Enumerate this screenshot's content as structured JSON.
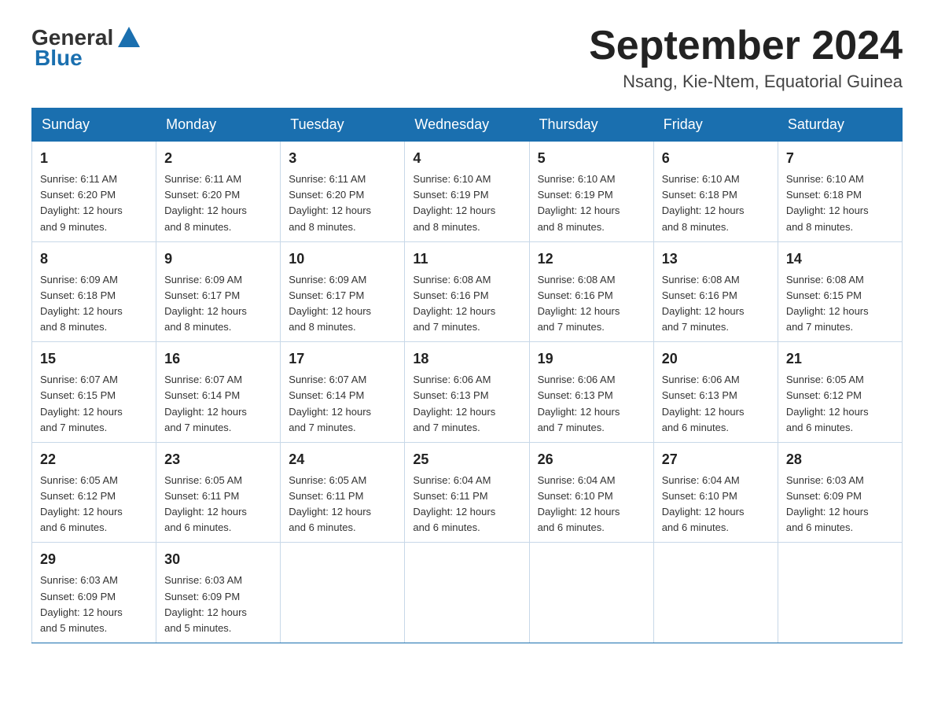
{
  "header": {
    "logo_general": "General",
    "logo_blue": "Blue",
    "month_title": "September 2024",
    "location": "Nsang, Kie-Ntem, Equatorial Guinea"
  },
  "days_of_week": [
    "Sunday",
    "Monday",
    "Tuesday",
    "Wednesday",
    "Thursday",
    "Friday",
    "Saturday"
  ],
  "weeks": [
    [
      {
        "day": "1",
        "sunrise": "6:11 AM",
        "sunset": "6:20 PM",
        "daylight": "12 hours and 9 minutes."
      },
      {
        "day": "2",
        "sunrise": "6:11 AM",
        "sunset": "6:20 PM",
        "daylight": "12 hours and 8 minutes."
      },
      {
        "day": "3",
        "sunrise": "6:11 AM",
        "sunset": "6:20 PM",
        "daylight": "12 hours and 8 minutes."
      },
      {
        "day": "4",
        "sunrise": "6:10 AM",
        "sunset": "6:19 PM",
        "daylight": "12 hours and 8 minutes."
      },
      {
        "day": "5",
        "sunrise": "6:10 AM",
        "sunset": "6:19 PM",
        "daylight": "12 hours and 8 minutes."
      },
      {
        "day": "6",
        "sunrise": "6:10 AM",
        "sunset": "6:18 PM",
        "daylight": "12 hours and 8 minutes."
      },
      {
        "day": "7",
        "sunrise": "6:10 AM",
        "sunset": "6:18 PM",
        "daylight": "12 hours and 8 minutes."
      }
    ],
    [
      {
        "day": "8",
        "sunrise": "6:09 AM",
        "sunset": "6:18 PM",
        "daylight": "12 hours and 8 minutes."
      },
      {
        "day": "9",
        "sunrise": "6:09 AM",
        "sunset": "6:17 PM",
        "daylight": "12 hours and 8 minutes."
      },
      {
        "day": "10",
        "sunrise": "6:09 AM",
        "sunset": "6:17 PM",
        "daylight": "12 hours and 8 minutes."
      },
      {
        "day": "11",
        "sunrise": "6:08 AM",
        "sunset": "6:16 PM",
        "daylight": "12 hours and 7 minutes."
      },
      {
        "day": "12",
        "sunrise": "6:08 AM",
        "sunset": "6:16 PM",
        "daylight": "12 hours and 7 minutes."
      },
      {
        "day": "13",
        "sunrise": "6:08 AM",
        "sunset": "6:16 PM",
        "daylight": "12 hours and 7 minutes."
      },
      {
        "day": "14",
        "sunrise": "6:08 AM",
        "sunset": "6:15 PM",
        "daylight": "12 hours and 7 minutes."
      }
    ],
    [
      {
        "day": "15",
        "sunrise": "6:07 AM",
        "sunset": "6:15 PM",
        "daylight": "12 hours and 7 minutes."
      },
      {
        "day": "16",
        "sunrise": "6:07 AM",
        "sunset": "6:14 PM",
        "daylight": "12 hours and 7 minutes."
      },
      {
        "day": "17",
        "sunrise": "6:07 AM",
        "sunset": "6:14 PM",
        "daylight": "12 hours and 7 minutes."
      },
      {
        "day": "18",
        "sunrise": "6:06 AM",
        "sunset": "6:13 PM",
        "daylight": "12 hours and 7 minutes."
      },
      {
        "day": "19",
        "sunrise": "6:06 AM",
        "sunset": "6:13 PM",
        "daylight": "12 hours and 7 minutes."
      },
      {
        "day": "20",
        "sunrise": "6:06 AM",
        "sunset": "6:13 PM",
        "daylight": "12 hours and 6 minutes."
      },
      {
        "day": "21",
        "sunrise": "6:05 AM",
        "sunset": "6:12 PM",
        "daylight": "12 hours and 6 minutes."
      }
    ],
    [
      {
        "day": "22",
        "sunrise": "6:05 AM",
        "sunset": "6:12 PM",
        "daylight": "12 hours and 6 minutes."
      },
      {
        "day": "23",
        "sunrise": "6:05 AM",
        "sunset": "6:11 PM",
        "daylight": "12 hours and 6 minutes."
      },
      {
        "day": "24",
        "sunrise": "6:05 AM",
        "sunset": "6:11 PM",
        "daylight": "12 hours and 6 minutes."
      },
      {
        "day": "25",
        "sunrise": "6:04 AM",
        "sunset": "6:11 PM",
        "daylight": "12 hours and 6 minutes."
      },
      {
        "day": "26",
        "sunrise": "6:04 AM",
        "sunset": "6:10 PM",
        "daylight": "12 hours and 6 minutes."
      },
      {
        "day": "27",
        "sunrise": "6:04 AM",
        "sunset": "6:10 PM",
        "daylight": "12 hours and 6 minutes."
      },
      {
        "day": "28",
        "sunrise": "6:03 AM",
        "sunset": "6:09 PM",
        "daylight": "12 hours and 6 minutes."
      }
    ],
    [
      {
        "day": "29",
        "sunrise": "6:03 AM",
        "sunset": "6:09 PM",
        "daylight": "12 hours and 5 minutes."
      },
      {
        "day": "30",
        "sunrise": "6:03 AM",
        "sunset": "6:09 PM",
        "daylight": "12 hours and 5 minutes."
      },
      null,
      null,
      null,
      null,
      null
    ]
  ],
  "labels": {
    "sunrise": "Sunrise:",
    "sunset": "Sunset:",
    "daylight": "Daylight:"
  }
}
